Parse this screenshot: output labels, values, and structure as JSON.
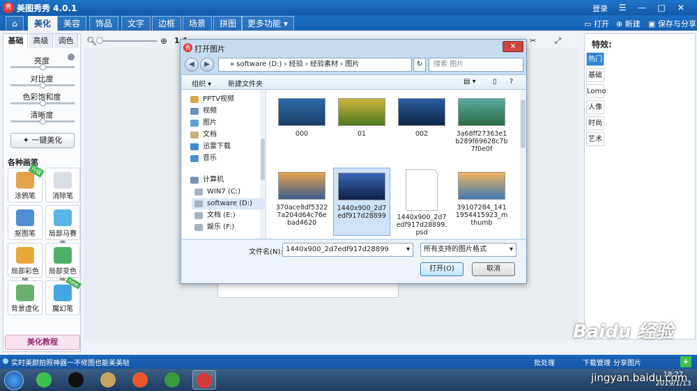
{
  "app": {
    "title": "美图秀秀 4.0.1",
    "logo_text": "秀",
    "login": "登录"
  },
  "window_controls": {
    "min": "—",
    "max": "□",
    "close": "✕"
  },
  "menu": {
    "tabs": [
      "美化",
      "美容",
      "饰品",
      "文字",
      "边框",
      "场景",
      "拼图",
      "更多功能 ▾"
    ],
    "active": "美化"
  },
  "top_actions": {
    "open": "打开",
    "new": "新建",
    "save": "保存与分享"
  },
  "left_panel": {
    "tabs": [
      "基础",
      "高级",
      "调色"
    ],
    "sliders": [
      "亮度",
      "对比度",
      "色彩饱和度",
      "清晰度"
    ],
    "onekey": "一键美化",
    "brush_title": "各种画笔",
    "tools": [
      {
        "label": "涂鸦笔",
        "color": "#e2a24a",
        "badge": "升级"
      },
      {
        "label": "消除笔",
        "color": "#d9dee5",
        "badge": ""
      },
      {
        "label": "抠图笔",
        "color": "#4f8fd1",
        "badge": ""
      },
      {
        "label": "局部马赛克",
        "color": "#5ab4e8",
        "badge": ""
      },
      {
        "label": "局部彩色笔",
        "color": "#e6a93a",
        "badge": ""
      },
      {
        "label": "局部变色笔",
        "color": "#4fb06a",
        "badge": ""
      },
      {
        "label": "背景虚化",
        "color": "#6bb06e",
        "badge": ""
      },
      {
        "label": "魔幻笔",
        "color": "#46a5e0",
        "badge": "new"
      }
    ],
    "tutorial": "美化教程"
  },
  "zoom": {
    "label": "1:1"
  },
  "right_panel": {
    "title": "特效:",
    "tabs": [
      "热门",
      "基础",
      "Lomo",
      "人像",
      "时尚",
      "艺术"
    ],
    "active": "热门"
  },
  "dialog": {
    "title": "打开图片",
    "close": "✕",
    "breadcrumb": "« software (D:) › 经验 › 经验素材 › 图片",
    "search_placeholder": "搜索 图片",
    "toolbar": {
      "organize": "组织 ▾",
      "new_folder": "新建文件夹"
    },
    "nav_items": [
      {
        "label": "PPTV视频",
        "color": "#d9a44a",
        "group": "fav"
      },
      {
        "label": "视频",
        "color": "#6a8fb8",
        "group": "fav"
      },
      {
        "label": "图片",
        "color": "#5f9ed4",
        "group": "fav"
      },
      {
        "label": "文档",
        "color": "#c8b07a",
        "group": "fav"
      },
      {
        "label": "迅雷下载",
        "color": "#3f8ad1",
        "group": "fav"
      },
      {
        "label": "音乐",
        "color": "#4f8fd1",
        "group": "fav"
      },
      {
        "label": "计算机",
        "color": "#7b93ad",
        "group": "pc"
      },
      {
        "label": "WIN7 (C:)",
        "color": "#a5b2bf",
        "group": "pc"
      },
      {
        "label": "software (D:)",
        "color": "#a5b2bf",
        "group": "pc",
        "selected": true
      },
      {
        "label": "文档 (E:)",
        "color": "#a5b2bf",
        "group": "pc"
      },
      {
        "label": "娱乐 (F:)",
        "color": "#a5b2bf",
        "group": "pc"
      }
    ],
    "files": [
      {
        "name": "000",
        "thumb": [
          "#2c6aa8",
          "#1a3e66"
        ]
      },
      {
        "name": "01",
        "thumb": [
          "#c9b53a",
          "#4f7a22"
        ]
      },
      {
        "name": "002",
        "thumb": [
          "#2a5fa0",
          "#0e2548"
        ]
      },
      {
        "name": "3a68ff27363e1b289f69628c7b7f0e0f",
        "thumb": [
          "#5aa9a0",
          "#2d6d45"
        ]
      },
      {
        "name": "370ace8df53227a204d64c76ebad4620",
        "thumb": [
          "#e3a24a",
          "#3d5e8f"
        ]
      },
      {
        "name": "1440x900_2d7edf917d28899",
        "thumb": [
          "#3a66b5",
          "#0d1f48"
        ],
        "selected": true
      },
      {
        "name": "1440x900_2d7edf917d28899.psd",
        "doc": true
      },
      {
        "name": "39107284_1411954415923_mthumb",
        "thumb": [
          "#f0b35a",
          "#3e7ab5"
        ]
      }
    ],
    "filename_label": "文件名(N):",
    "filename_value": "1440x900_2d7edf917d28899",
    "filetype": "所有支持的图片格式",
    "open": "打开(O)",
    "cancel": "取消"
  },
  "status": {
    "text": "实时美颜拍照神器一不修图也能美美哒",
    "batch": "批处理",
    "download": "下载管理",
    "share": "分享图片"
  },
  "taskbar": {
    "apps": [
      "#3fbf4f",
      "#111",
      "#c9a45c",
      "#e8582a",
      "#3a9a3a",
      "#d63a3a"
    ],
    "time": "18:27",
    "date": "2019/1/13"
  },
  "watermark": {
    "text": "Baidu 经验",
    "url": "jingyan.baidu.com"
  }
}
